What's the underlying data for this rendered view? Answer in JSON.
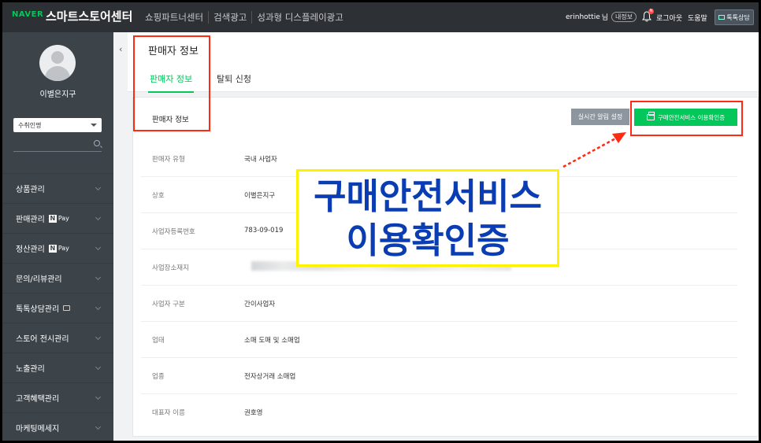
{
  "topbar": {
    "logo": "NAVER",
    "brand": "스마트스토어센터",
    "nav": [
      "쇼핑파트너센터",
      "검색광고",
      "성과형 디스플레이광고"
    ],
    "user": "erinhottie",
    "user_suffix": "님",
    "my_info": "내정보",
    "notification_count": "N",
    "logout": "로그아웃",
    "help": "도움말",
    "talk_button": "톡톡상담"
  },
  "sidebar": {
    "store_name": "이별은지구",
    "select_value": "수취인명",
    "items": [
      {
        "label": "상품관리"
      },
      {
        "label": "판매관리",
        "badge": "Pay"
      },
      {
        "label": "정산관리",
        "badge": "Pay"
      },
      {
        "label": "문의/리뷰관리"
      },
      {
        "label": "톡톡상담관리"
      },
      {
        "label": "스토어 전시관리"
      },
      {
        "label": "노출관리"
      },
      {
        "label": "고객혜택관리"
      },
      {
        "label": "마케팅메세지"
      }
    ],
    "npay_letter": "N"
  },
  "main": {
    "page_title": "판매자 정보",
    "tabs": [
      {
        "label": "판매자 정보",
        "active": true
      },
      {
        "label": "탈퇴 신청",
        "active": false
      }
    ],
    "card_title": "판매자 정보",
    "alert_button": "실시간 알림 설정",
    "cert_button": "구매안전서비스 이용확인증",
    "rows": [
      {
        "key": "판매자 유형",
        "value": "국내 사업자"
      },
      {
        "key": "상호",
        "value": "이별은지구"
      },
      {
        "key": "사업자등록번호",
        "value": "783-09-019"
      },
      {
        "key": "사업장소재지",
        "value": ""
      },
      {
        "key": "사업자 구분",
        "value": "간이사업자"
      },
      {
        "key": "업태",
        "value": "소매 도매 및 소매업"
      },
      {
        "key": "업종",
        "value": "전자상거래 소매업"
      },
      {
        "key": "대표자 이름",
        "value": "권호영"
      }
    ]
  },
  "annotation": {
    "line1": "구매안전서비스",
    "line2": "이용확인증",
    "colors": {
      "box": "#ff2a12",
      "callout_border": "#fff200",
      "callout_text": "#0a3db4"
    }
  },
  "colors": {
    "accent": "#03c75a",
    "topbar": "#2d3135",
    "sidebar": "#3c4349"
  }
}
